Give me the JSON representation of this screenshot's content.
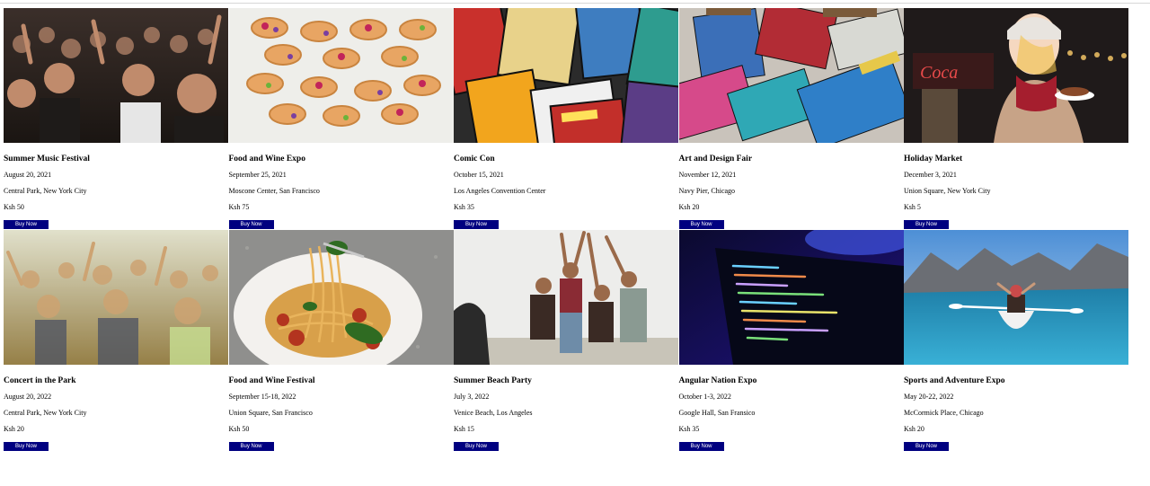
{
  "events": [
    {
      "title": "Summer Music Festival",
      "date": "August 20, 2021",
      "venue": "Central Park, New York City",
      "price": "Ksh 50",
      "button": "Buy Now",
      "image": "concert-crowd-photo"
    },
    {
      "title": "Food and Wine Expo",
      "date": "September 25, 2021",
      "venue": "Moscone Center, San Francisco",
      "price": "Ksh 75",
      "button": "Buy Now",
      "image": "fruit-tarts-photo"
    },
    {
      "title": "Comic Con",
      "date": "October 15, 2021",
      "venue": "Los Angeles Convention Center",
      "price": "Ksh 35",
      "button": "Buy Now",
      "image": "comic-books-photo"
    },
    {
      "title": "Art and Design Fair",
      "date": "November 12, 2021",
      "venue": "Navy Pier, Chicago",
      "price": "Ksh 20",
      "button": "Buy Now",
      "image": "paint-brushes-photo"
    },
    {
      "title": "Holiday Market",
      "date": "December 3, 2021",
      "venue": "Union Square, New York City",
      "price": "Ksh 5",
      "button": "Buy Now",
      "image": "winter-market-photo"
    },
    {
      "title": "Concert in the Park",
      "date": "August 20, 2022",
      "venue": "Central Park, New York City",
      "price": "Ksh 20",
      "button": "Buy Now",
      "image": "dancing-crowd-photo"
    },
    {
      "title": "Food and Wine Festival",
      "date": "September 15-18, 2022",
      "venue": "Union Square, San Francisco",
      "price": "Ksh 50",
      "button": "Buy Now",
      "image": "spaghetti-plate-photo"
    },
    {
      "title": "Summer Beach Party",
      "date": "July 3, 2022",
      "venue": "Venice Beach, Los Angeles",
      "price": "Ksh 15",
      "button": "Buy Now",
      "image": "beach-friends-photo"
    },
    {
      "title": "Angular Nation Expo",
      "date": "October 1-3, 2022",
      "venue": "Google Hall, San Fransico",
      "price": "Ksh 35",
      "button": "Buy Now",
      "image": "code-laptop-photo"
    },
    {
      "title": "Sports and Adventure Expo",
      "date": "May 20-22, 2022",
      "venue": "McCormick Place, Chicago",
      "price": "Ksh 20",
      "button": "Buy Now",
      "image": "kayak-lake-photo"
    }
  ],
  "colors": {
    "button_bg": "#000080",
    "button_text": "#ffffff",
    "page_bg": "#ffffff"
  }
}
